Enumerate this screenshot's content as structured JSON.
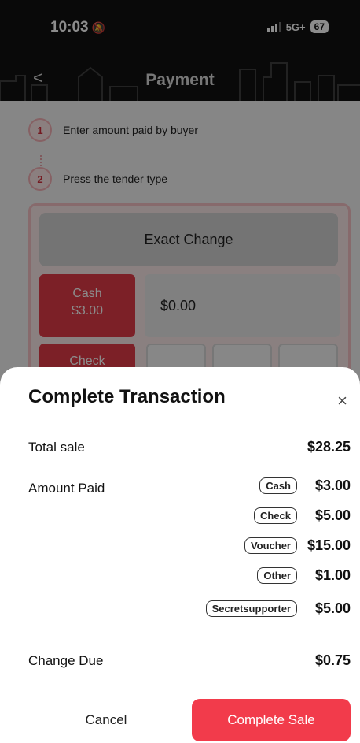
{
  "status_bar": {
    "time": "10:03",
    "network": "5G+",
    "battery": "67"
  },
  "header": {
    "title": "Payment",
    "back_glyph": "<"
  },
  "steps": [
    {
      "num": "1",
      "text": "Enter amount paid by buyer"
    },
    {
      "num": "2",
      "text": "Press the tender type"
    }
  ],
  "pad": {
    "exact_change": "Exact Change",
    "cash_label": "Cash",
    "cash_amount": "$3.00",
    "check_label": "Check",
    "amount_display": "$0.00"
  },
  "sheet": {
    "title": "Complete Transaction",
    "close_glyph": "×",
    "total_sale_label": "Total sale",
    "total_sale_value": "$28.25",
    "amount_paid_label": "Amount Paid",
    "payments": [
      {
        "type": "Cash",
        "amount": "$3.00"
      },
      {
        "type": "Check",
        "amount": "$5.00"
      },
      {
        "type": "Voucher",
        "amount": "$15.00"
      },
      {
        "type": "Other",
        "amount": "$1.00"
      },
      {
        "type": "Secretsupporter",
        "amount": "$5.00"
      }
    ],
    "change_due_label": "Change Due",
    "change_due_value": "$0.75",
    "cancel_label": "Cancel",
    "complete_label": "Complete Sale"
  },
  "colors": {
    "accent": "#f23b4b",
    "tender": "#e23b47",
    "header_bg": "#121212"
  }
}
